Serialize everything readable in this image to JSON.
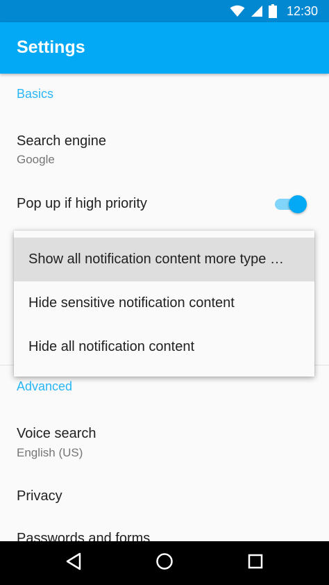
{
  "status_bar": {
    "time": "12:30",
    "icons": [
      "wifi-icon",
      "cell-signal-icon",
      "battery-icon"
    ]
  },
  "app_bar": {
    "title": "Settings"
  },
  "colors": {
    "status_bar": "#0288d1",
    "app_bar": "#03a9f4",
    "accent": "#29b6f6",
    "switch_track": "#81d4fa"
  },
  "sections": {
    "basics": {
      "header": "Basics",
      "search_engine": {
        "title": "Search engine",
        "summary": "Google"
      },
      "popup_priority": {
        "title": "Pop up if high priority",
        "enabled": true
      }
    },
    "advanced": {
      "header": "Advanced",
      "voice_search": {
        "title": "Voice search",
        "summary": "English (US)"
      },
      "privacy": {
        "title": "Privacy"
      },
      "passwords": {
        "title": "Passwords and forms"
      }
    }
  },
  "popup_menu": {
    "items": [
      {
        "label": "Show all notification content more type …",
        "selected": true
      },
      {
        "label": "Hide sensitive notification content",
        "selected": false
      },
      {
        "label": "Hide all notification content",
        "selected": false
      }
    ]
  },
  "nav_bar": {
    "buttons": [
      "back-icon",
      "home-icon",
      "recents-icon"
    ]
  }
}
